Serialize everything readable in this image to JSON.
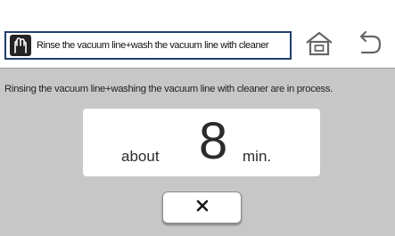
{
  "header": {
    "title": "Rinse the vacuum line+wash the vacuum line with cleaner",
    "title_icon": "hands-icon",
    "home_icon": "home-icon",
    "back_icon": "back-arrow-icon"
  },
  "status": {
    "message": "Rinsing the vacuum line+washing the vacuum line with cleaner are in process."
  },
  "timer": {
    "prefix": "about",
    "value": "8",
    "unit": "min."
  },
  "actions": {
    "cancel_icon": "close-icon"
  },
  "colors": {
    "background": "#c7c7c7",
    "title_border": "#1f3f6e",
    "card": "#ffffff"
  }
}
